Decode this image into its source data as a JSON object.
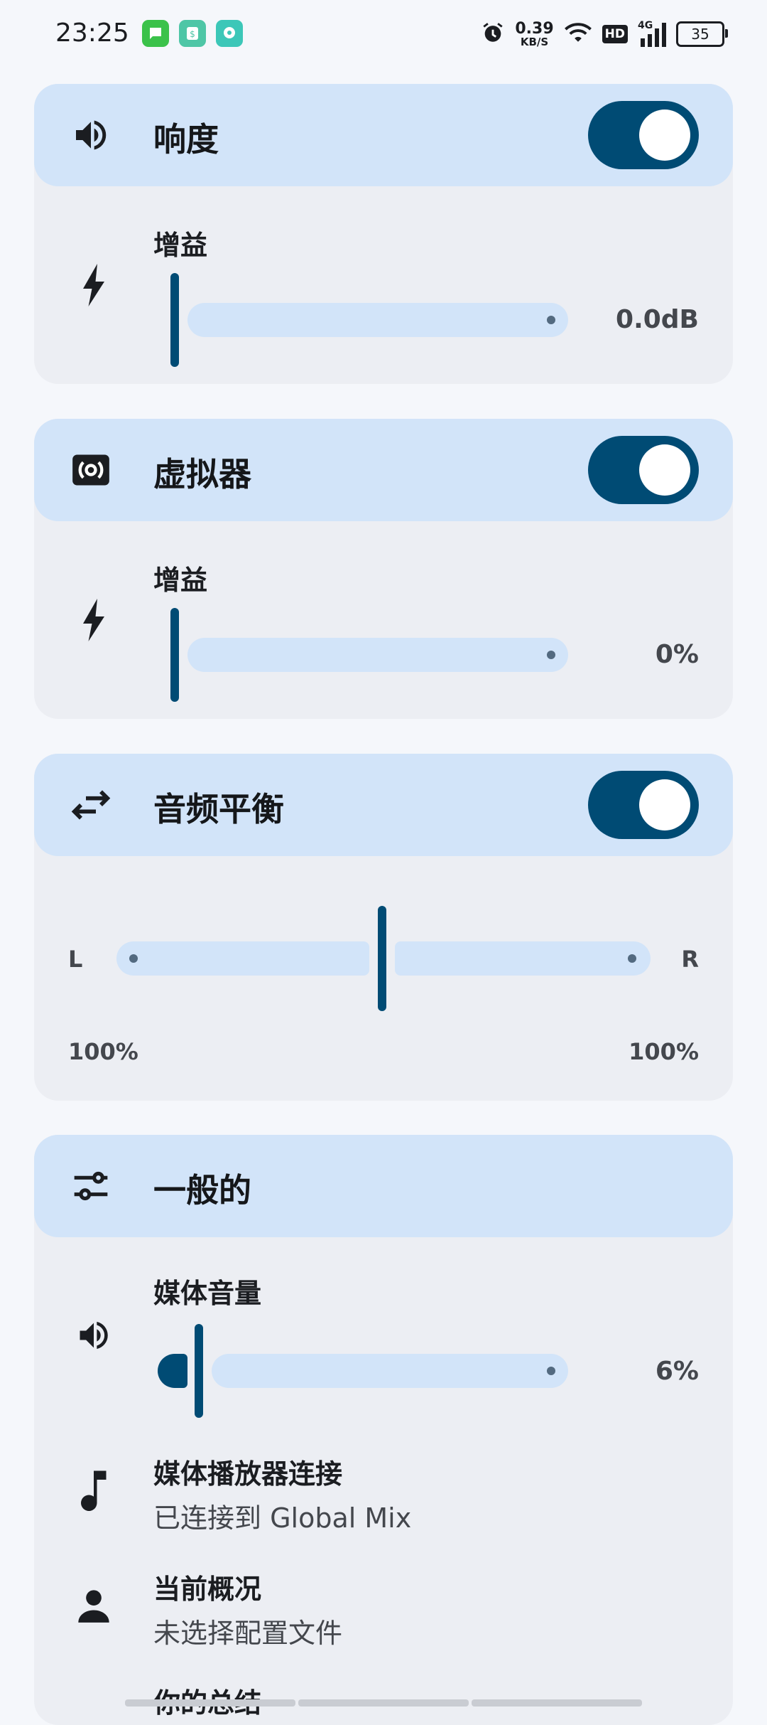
{
  "status_bar": {
    "time": "23:25",
    "net_speed_value": "0.39",
    "net_speed_unit": "KB/S",
    "hd_label": "HD",
    "network_label": "4G",
    "battery": "35",
    "colors": {
      "notif1": "#3bc24a",
      "notif2": "#4ec6a6",
      "notif3": "#3cc7b8"
    }
  },
  "loudness": {
    "title": "响度",
    "enabled": true,
    "gain_label": "增益",
    "gain_value": "0.0dB",
    "gain_fraction": 0
  },
  "virtualizer": {
    "title": "虚拟器",
    "enabled": true,
    "gain_label": "增益",
    "gain_value": "0%",
    "gain_fraction": 0
  },
  "balance": {
    "title": "音频平衡",
    "enabled": true,
    "left_label": "L",
    "right_label": "R",
    "left_pct": "100%",
    "right_pct": "100%",
    "position_fraction": 0.5
  },
  "general": {
    "title": "一般的",
    "media_volume_label": "媒体音量",
    "media_volume_value": "6%",
    "media_volume_fraction": 0.06,
    "player_connection_label": "媒体播放器连接",
    "player_connection_value": "已连接到 Global Mix",
    "profile_label": "当前概况",
    "profile_value": "未选择配置文件",
    "summary_label": "你的总结"
  },
  "theme": {
    "accent": "#004b74",
    "header_bg": "#d2e4f9",
    "card_bg": "#eceef3",
    "track": "#d2e4f9"
  },
  "icons": {
    "loudness": "volume-up-icon",
    "virtualizer": "surround-icon",
    "gain": "bolt-icon",
    "balance": "swap-horiz-icon",
    "general": "tune-icon",
    "media_volume": "volume-up-icon",
    "player": "music-note-icon",
    "profile": "person-icon"
  }
}
